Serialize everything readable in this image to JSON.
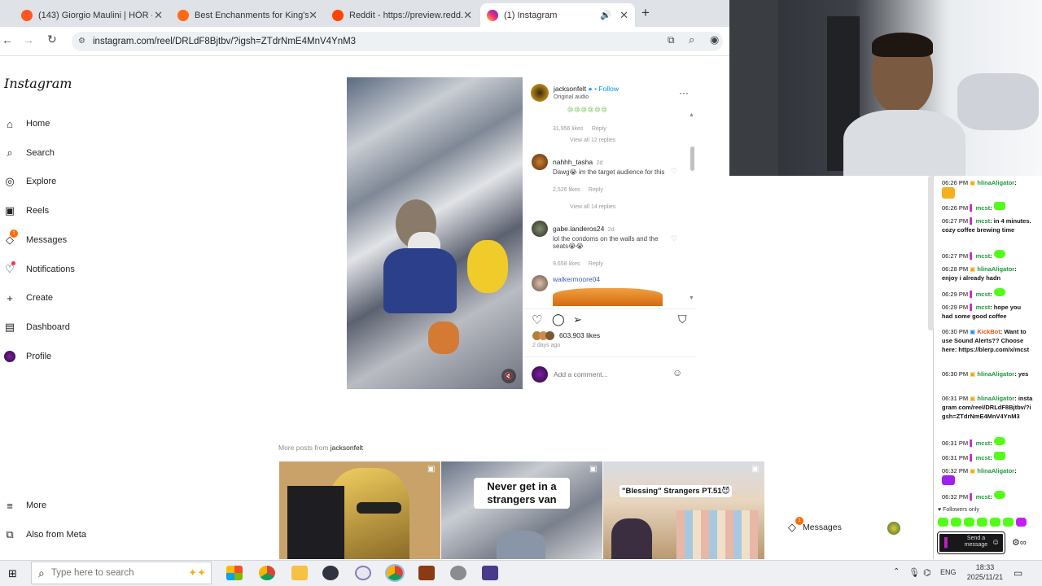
{
  "browser": {
    "tabs": [
      {
        "title": "(143) Giorgio Maulini | HÖR - N",
        "favicon_color": "#ff5722"
      },
      {
        "title": "Best Enchanments for King's Ed",
        "favicon_color": "#ff6a13"
      },
      {
        "title": "Reddit - https://preview.redd.it",
        "favicon_color": "#ff4500"
      },
      {
        "title": "(1) Instagram",
        "favicon_color": "#c13584",
        "active": true
      }
    ],
    "new_tab_label": "+",
    "url": "instagram.com/reel/DRLdF8Bjtbv/?igsh=ZTdrNmE4MnV4YnM3"
  },
  "instagram": {
    "logo": "Instagram",
    "nav": [
      {
        "label": "Home",
        "icon": "home-icon"
      },
      {
        "label": "Search",
        "icon": "search-icon"
      },
      {
        "label": "Explore",
        "icon": "compass-icon"
      },
      {
        "label": "Reels",
        "icon": "reels-icon"
      },
      {
        "label": "Messages",
        "icon": "messenger-icon",
        "badge": "1"
      },
      {
        "label": "Notifications",
        "icon": "heart-icon"
      },
      {
        "label": "Create",
        "icon": "plus-icon"
      },
      {
        "label": "Dashboard",
        "icon": "dashboard-icon"
      },
      {
        "label": "Profile",
        "icon": "avatar-icon"
      }
    ],
    "more_label": "More",
    "also_from_meta": "Also from Meta",
    "post": {
      "username": "jacksonfelt",
      "follow_label": "Follow",
      "audio": "Original audio",
      "emoji_line": "😢😢😢😢😢😢",
      "top_likes": "31,956 likes",
      "reply_label": "Reply",
      "view_replies_1": "View all 12 replies",
      "comments": [
        {
          "user": "nahhh_tasha",
          "age": "2d",
          "text": "Dawg😭 im the target audience for this",
          "likes": "2,526 likes"
        },
        {
          "user": "gabe.landeros24",
          "age": "2d",
          "text": "lol the condoms on the walls and the seats😭😭",
          "likes": "9,658 likes"
        },
        {
          "user": "walkermoore04",
          "age": "",
          "text": "",
          "likes": ""
        }
      ],
      "view_replies_2": "View all 14 replies",
      "likes_total": "603,903 likes",
      "date": "2 days ago",
      "comment_placeholder": "Add a comment..."
    },
    "more_posts_prefix": "More posts from",
    "more_posts_user": "jacksonfelt",
    "thumbnails": [
      {
        "caption": ""
      },
      {
        "caption": "Never get in a strangers van"
      },
      {
        "caption": "\"Blessing\" Strangers PT.51😈"
      }
    ],
    "messages_float": {
      "label": "Messages",
      "badge": "1"
    }
  },
  "chat": {
    "lines": [
      {
        "time": "06:26 PM",
        "user": "hlinaAligator",
        "msg": ""
      },
      {
        "time": "06:26 PM",
        "user": "mcst",
        "msg": ""
      },
      {
        "time": "06:27 PM",
        "user": "mcst",
        "msg": "in 4 minutes. cozy coffee brewing time"
      },
      {
        "time": "06:27 PM",
        "user": "mcst",
        "msg": ""
      },
      {
        "time": "06:28 PM",
        "user": "hlinaAligator",
        "msg": "enjoy i already hadn"
      },
      {
        "time": "06:29 PM",
        "user": "mcst",
        "msg": ""
      },
      {
        "time": "06:29 PM",
        "user": "mcst",
        "msg": "hope you had some good coffee"
      },
      {
        "time": "06:30 PM",
        "user": "KickBot",
        "msg": "Want to use Sound Alerts?? Choose here: https://blerp.com/x/mcst"
      },
      {
        "time": "06:30 PM",
        "user": "hlinaAligator",
        "msg": "yes"
      },
      {
        "time": "06:31 PM",
        "user": "hlinaAligator",
        "msg": "instagram com/reel/DRLdF8Bjtbv/?igsh=ZTdrNmE4MnV4YnM3"
      },
      {
        "time": "06:31 PM",
        "user": "mcst",
        "msg": ""
      },
      {
        "time": "06:31 PM",
        "user": "mcst",
        "msg": ""
      },
      {
        "time": "06:32 PM",
        "user": "hlinaAligator",
        "msg": ""
      },
      {
        "time": "06:32 PM",
        "user": "mcst",
        "msg": ""
      }
    ],
    "followers_only": "Followers only",
    "send_placeholder": "Send a message"
  },
  "taskbar": {
    "search_placeholder": "Type here to search",
    "lang": "ENG",
    "time": "18:33",
    "date": "2025/11/21"
  }
}
